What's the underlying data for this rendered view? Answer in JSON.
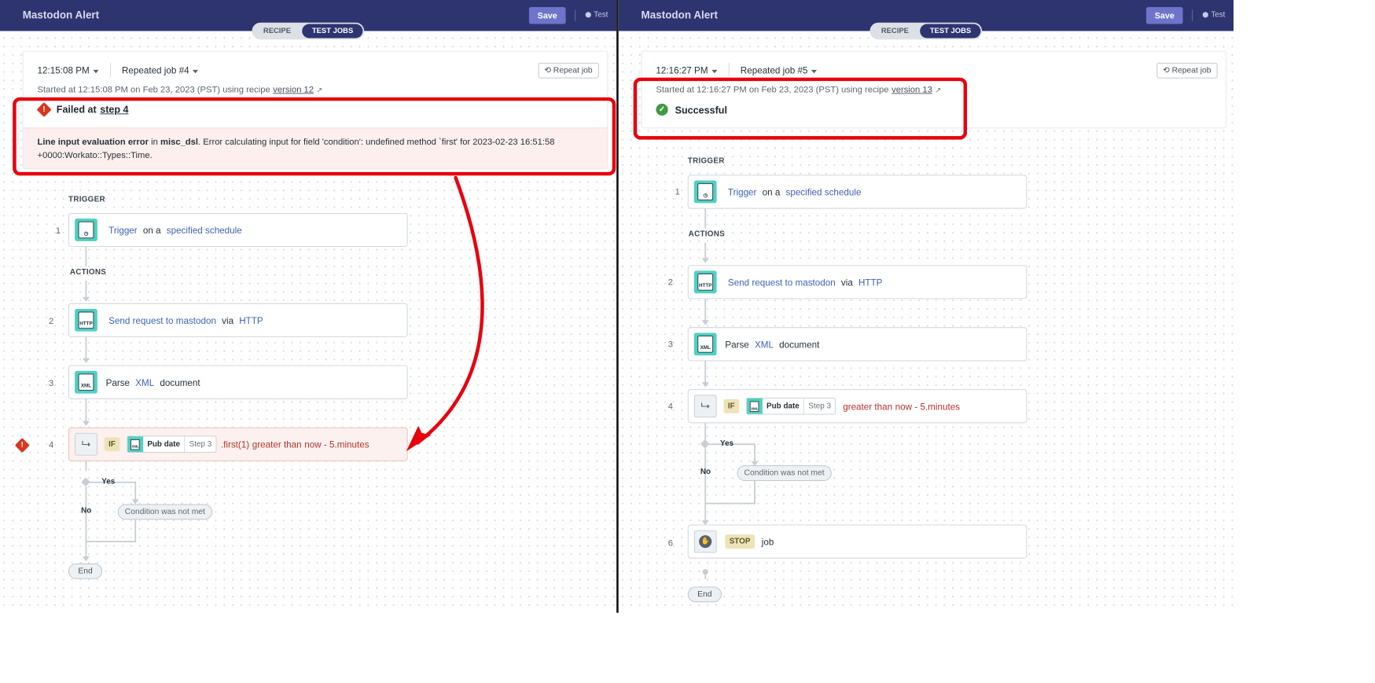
{
  "left": {
    "app_title": "Mastodon Alert",
    "save_label": "Save",
    "test_label": "Test",
    "tabs": [
      "RECIPE",
      "TEST JOBS"
    ],
    "time": "12:15:08 PM",
    "job": "Repeated job #4",
    "repeat_label": "Repeat job",
    "started_text": "Started at 12:15:08 PM on Feb 23, 2023 (PST) using recipe",
    "version": "version 12",
    "status_prefix": "Failed at",
    "status_step": "step 4",
    "error_title": "Line input evaluation error",
    "error_in": "in",
    "error_module": "misc_dsl",
    "error_message": ". Error calculating input for field 'condition': undefined method `first' for 2023-02-23 16:51:58 +0000:Workato::Types::Time.",
    "trigger_label": "TRIGGER",
    "actions_label": "ACTIONS",
    "steps": [
      {
        "num": "1",
        "parts": [
          "Trigger",
          "on a",
          "specified schedule"
        ]
      },
      {
        "num": "2",
        "parts": [
          "Send request to mastodon",
          "via",
          "HTTP"
        ]
      },
      {
        "num": "3",
        "parts": [
          "Parse",
          "XML",
          "document"
        ]
      },
      {
        "num": "4",
        "kw": "IF",
        "pill_name": "Pub date",
        "pill_step": "Step 3",
        "parts": [
          ".first(1)",
          "greater than",
          "now - 5.minutes"
        ]
      }
    ],
    "yes_label": "Yes",
    "no_label": "No",
    "condition_label": "Condition was not met",
    "end_label": "End"
  },
  "right": {
    "app_title": "Mastodon Alert",
    "save_label": "Save",
    "test_label": "Test",
    "tabs": [
      "RECIPE",
      "TEST JOBS"
    ],
    "time": "12:16:27 PM",
    "job": "Repeated job #5",
    "repeat_label": "Repeat job",
    "started_text": "Started at 12:16:27 PM on Feb 23, 2023 (PST) using recipe",
    "version": "version 13",
    "status_label": "Successful",
    "trigger_label": "TRIGGER",
    "actions_label": "ACTIONS",
    "steps": [
      {
        "num": "1",
        "parts": [
          "Trigger",
          "on a",
          "specified schedule"
        ]
      },
      {
        "num": "2",
        "parts": [
          "Send request to mastodon",
          "via",
          "HTTP"
        ]
      },
      {
        "num": "3",
        "parts": [
          "Parse",
          "XML",
          "document"
        ]
      },
      {
        "num": "4",
        "kw": "IF",
        "pill_name": "Pub date",
        "pill_step": "Step 3",
        "parts": [
          "greater than",
          "now - 5.minutes"
        ]
      },
      {
        "num": "6",
        "kw": "STOP",
        "parts": [
          "job"
        ]
      }
    ],
    "yes_label": "Yes",
    "no_label": "No",
    "condition_label": "Condition was not met",
    "end_label": "End"
  },
  "icons": {
    "error": "error-diamond-icon",
    "success": "check-circle-icon",
    "schedule": "calendar-clock-icon",
    "http": "http-document-icon",
    "xml": "xml-document-icon",
    "if": "branch-icon",
    "stop": "stop-hand-icon",
    "repeat": "repeat-icon",
    "external": "external-link-icon"
  },
  "colors": {
    "topbar": "#2e3470",
    "annotation": "#e8000d",
    "error": "#d9361f",
    "success": "#3f9a45",
    "app_icon": "#4fd0c2"
  }
}
